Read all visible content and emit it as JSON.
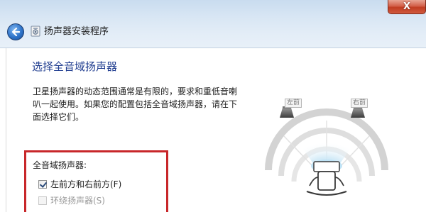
{
  "window": {
    "title": "扬声器安装程序",
    "close_symbol": "X"
  },
  "page": {
    "heading": "选择全音域扬声器",
    "description_lines": [
      "卫星扬声器的动态范围通常是有限的，要求和重低音喇",
      "叭一起使用。如果您的配置包括全音域扬声器，请在下",
      "面选择它们。"
    ]
  },
  "group": {
    "label": "全音域扬声器:",
    "options": [
      {
        "label": "左前方和右前方(F)",
        "checked": true,
        "enabled": true
      },
      {
        "label": "环绕扬声器(S)",
        "checked": false,
        "enabled": false
      }
    ]
  },
  "diagram": {
    "front_left_label": "左前",
    "front_right_label": "右前"
  },
  "colors": {
    "heading": "#1f3c8f",
    "highlight": "#c8272a",
    "close_button": "#c13d22"
  },
  "icons": [
    "back-arrow-icon",
    "wizard-icon",
    "close-icon",
    "speaker-icon"
  ]
}
